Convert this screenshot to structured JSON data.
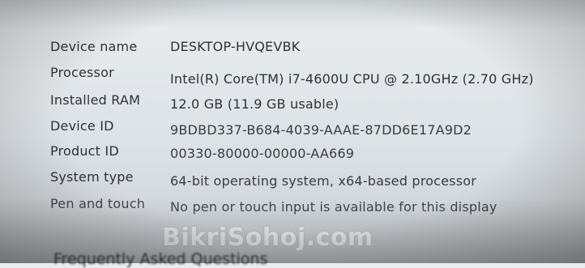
{
  "specs": {
    "rows": [
      {
        "label": "Device name",
        "value": "DESKTOP-HVQEVBK"
      },
      {
        "label": "Processor",
        "value": "Intel(R) Core(TM) i7-4600U CPU @ 2.10GHz (2.70 GHz)"
      },
      {
        "label": "Installed RAM",
        "value": "12.0 GB (11.9 GB usable)"
      },
      {
        "label": "Device ID",
        "value": "9BDBD337-B684-4039-AAAE-87DD6E17A9D2"
      },
      {
        "label": "Product ID",
        "value": "00330-80000-00000-AA669"
      },
      {
        "label": "System type",
        "value": "64-bit operating system, x64-based processor"
      },
      {
        "label": "Pen and touch",
        "value": "No pen or touch input is available for this display"
      }
    ]
  },
  "faq": {
    "heading": "Frequently Asked Questions"
  },
  "watermark": {
    "text": "BikriSohoj.com"
  }
}
